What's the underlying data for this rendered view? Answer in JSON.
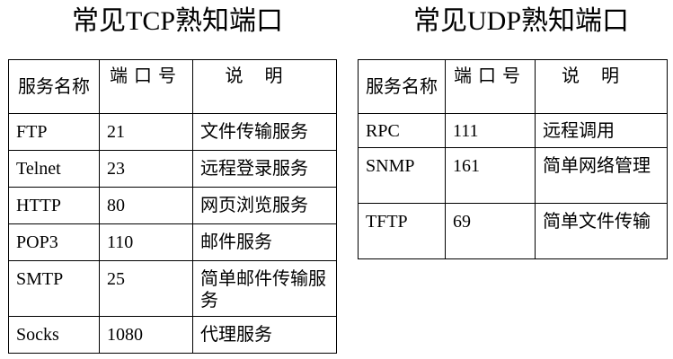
{
  "tcp": {
    "title": "常见TCP熟知端口",
    "headers": [
      "服务名称",
      "端口号",
      "说明"
    ],
    "rows": [
      {
        "service": "FTP",
        "port": "21",
        "desc": "文件传输服务"
      },
      {
        "service": "Telnet",
        "port": "23",
        "desc": "远程登录服务"
      },
      {
        "service": "HTTP",
        "port": "80",
        "desc": "网页浏览服务"
      },
      {
        "service": "POP3",
        "port": "110",
        "desc": "邮件服务"
      },
      {
        "service": "SMTP",
        "port": "25",
        "desc": "简单邮件传输服务"
      },
      {
        "service": "Socks",
        "port": "1080",
        "desc": "代理服务"
      }
    ]
  },
  "udp": {
    "title": "常见UDP熟知端口",
    "headers": [
      "服务名称",
      "端口号",
      "说明"
    ],
    "rows": [
      {
        "service": "RPC",
        "port": "111",
        "desc": "远程调用"
      },
      {
        "service": "SNMP",
        "port": "161",
        "desc": "简单网络管理"
      },
      {
        "service": "TFTP",
        "port": "69",
        "desc": "简单文件传输"
      }
    ]
  }
}
